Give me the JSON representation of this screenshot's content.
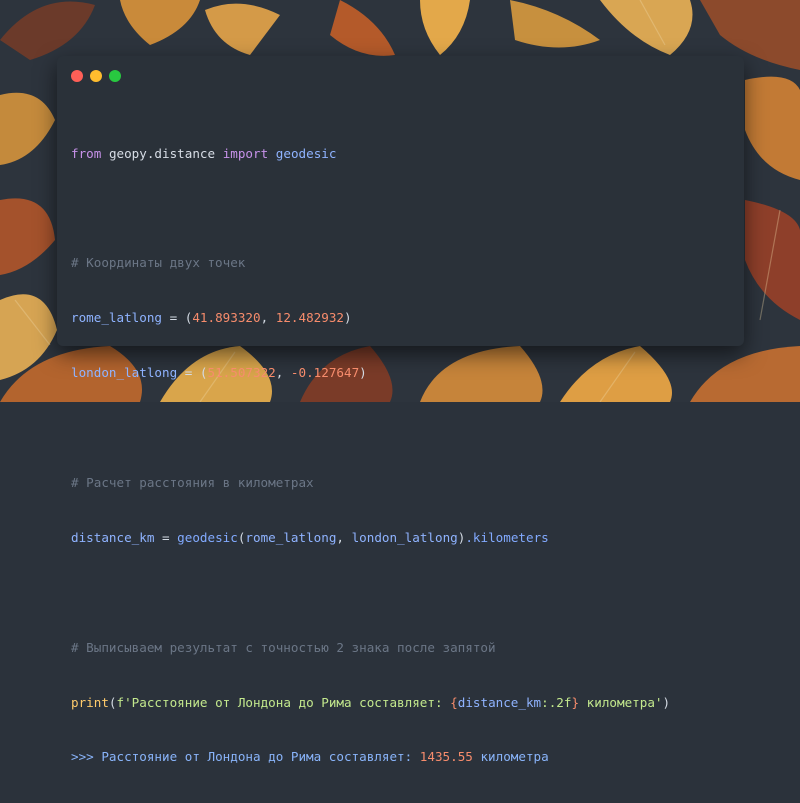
{
  "window": {
    "traffic_lights": [
      {
        "name": "close",
        "color": "#ff5f57"
      },
      {
        "name": "minimize",
        "color": "#febc2e"
      },
      {
        "name": "maximize",
        "color": "#28c840"
      }
    ]
  },
  "code": {
    "import_from": "from",
    "import_module": "geopy.distance",
    "import_kw": "import",
    "import_name": "geodesic",
    "comment_coords": "# Координаты двух точек",
    "rome_var": "rome_latlong",
    "rome_eq": " = (",
    "rome_lat": "41.893320",
    "rome_sep": ", ",
    "rome_lon": "12.482932",
    "rome_close": ")",
    "london_var": "london_latlong",
    "london_eq": " = (",
    "london_lat": "51.507322",
    "london_sep": ", ",
    "london_lon": "-0.127647",
    "london_close": ")",
    "comment_calc": "# Расчет расстояния в километрах",
    "dist_var": "distance_km",
    "dist_eq": " = ",
    "dist_fn": "geodesic",
    "dist_args_open": "(",
    "dist_arg1": "rome_latlong",
    "dist_arg_sep": ", ",
    "dist_arg2": "london_latlong",
    "dist_args_close": ")",
    "dist_attr": ".kilometers",
    "comment_print": "# Выписываем результат с точностью 2 знака после запятой",
    "print_fn": "print",
    "print_open": "(",
    "print_str_start": "f'Расстояние от Лондона до Рима составляет: ",
    "print_brace_open": "{",
    "print_expr": "distance_km",
    "print_fmt": ":.2f",
    "print_brace_close": "}",
    "print_str_end": " километра'",
    "print_close": ")",
    "output_prompt": ">>> ",
    "output_text": "Расстояние от Лондона до Рима составляет: ",
    "output_value": "1435.55",
    "output_suffix": " километра"
  }
}
